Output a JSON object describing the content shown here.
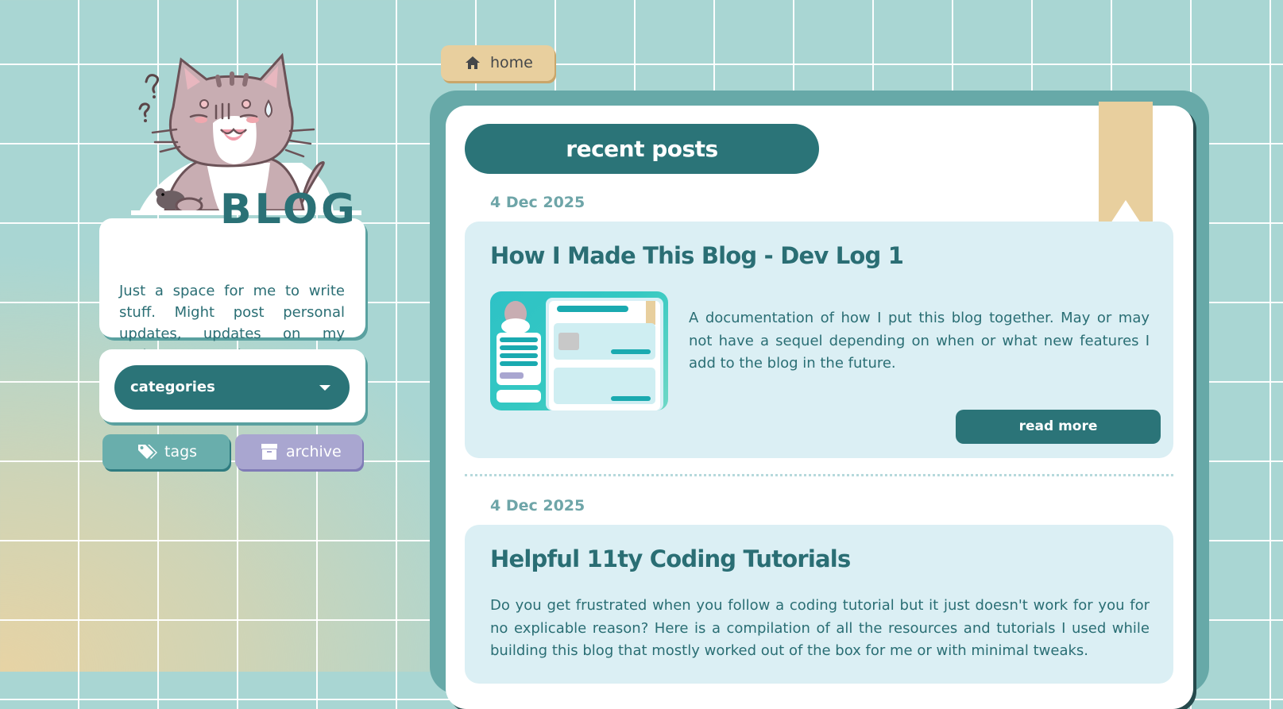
{
  "nav": {
    "home_label": "home"
  },
  "sidebar": {
    "logo_word": "BLOG",
    "description": "Just a space for me to write stuff. Might post personal updates, updates on my projects or maybe even some resources.",
    "categories_label": "categories",
    "tags_label": "tags",
    "archive_label": "archive"
  },
  "main": {
    "header": "recent posts",
    "posts": [
      {
        "date": "4 Dec 2025",
        "title": "How I Made This Blog - Dev Log 1",
        "excerpt": "A documentation of how I put this blog together. May or may not have a sequel depending on when or what new features I add to the blog in the future.",
        "read_more_label": "read more"
      },
      {
        "date": "4 Dec 2025",
        "title": "Helpful 11ty Coding Tutorials",
        "excerpt": "Do you get frustrated when you follow a coding tutorial but it just doesn't work for you for no explicable reason? Here is a compilation of all the resources and tutorials I used while building this blog that mostly worked out of the box for me or with minimal tweaks."
      }
    ]
  },
  "colors": {
    "teal_dark": "#2b7478",
    "teal_mid": "#67a9a8",
    "card_light": "#dbeff4",
    "bookmark": "#e8cf9e",
    "archive_purple": "#a9a6d0"
  },
  "icons": [
    "home-icon",
    "tag-icon",
    "archive-box-icon",
    "chevron-down-icon",
    "bookmark-icon",
    "cat-mascot-icon"
  ]
}
